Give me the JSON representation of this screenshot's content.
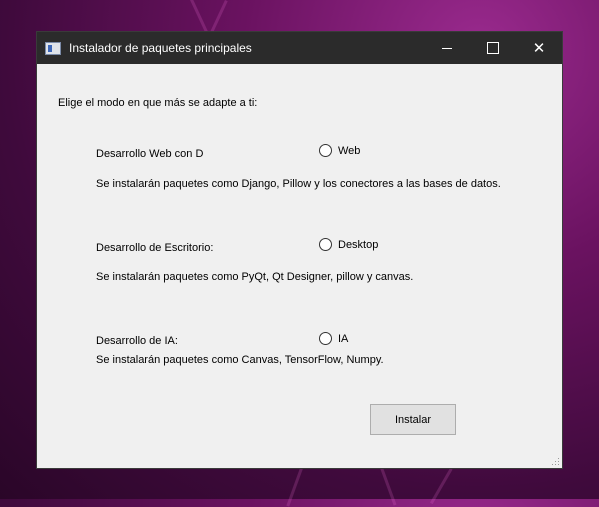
{
  "window": {
    "title": "Instalador de paquetes principales",
    "controls": {
      "minimize": "minimize-icon",
      "maximize": "maximize-icon",
      "close": "close-icon"
    }
  },
  "main": {
    "prompt": "Elige el modo en que más se adapte a ti:",
    "options": [
      {
        "label": "Desarrollo Web con D",
        "radio_label": "Web",
        "selected": false,
        "description": "Se instalarán paquetes como Django, Pillow y los conectores a las bases de datos."
      },
      {
        "label": "Desarrollo de Escritorio:",
        "radio_label": "Desktop",
        "selected": false,
        "description": "Se instalarán paquetes como PyQt, Qt Designer, pillow y canvas."
      },
      {
        "label": "Desarrollo de IA:",
        "radio_label": "IA",
        "selected": false,
        "description": "Se instalarán paquetes como Canvas, TensorFlow, Numpy."
      }
    ],
    "install_button": "Instalar"
  },
  "colors": {
    "titlebar": "#2b2b2b",
    "window_bg": "#f0f0f0",
    "button_bg": "#e1e1e1"
  }
}
